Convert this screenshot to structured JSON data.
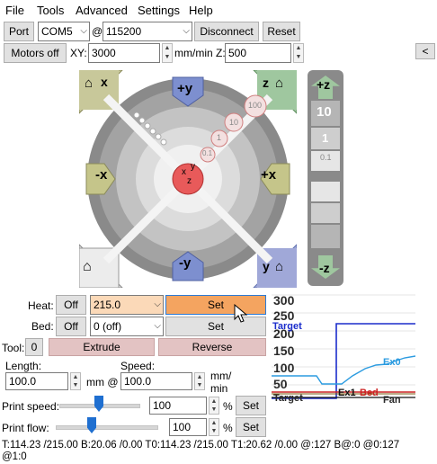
{
  "menu": [
    "File",
    "Tools",
    "Advanced",
    "Settings",
    "Help"
  ],
  "connection": {
    "port_label": "Port",
    "port_value": "COM5",
    "at": "@",
    "baud_value": "115200",
    "disconnect_label": "Disconnect",
    "reset_label": "Reset"
  },
  "motion": {
    "motors_off_label": "Motors off",
    "xy_label": "XY:",
    "xy_speed": "3000",
    "unit_label": "mm/min Z:",
    "z_speed": "500",
    "collapse_label": "<"
  },
  "jog": {
    "home_x": "x",
    "home_z": "z",
    "home_y": "y",
    "plus_y": "+y",
    "minus_y": "-y",
    "plus_x": "+x",
    "minus_x": "-x",
    "steps": [
      "100",
      "10",
      "1",
      "0.1"
    ],
    "center_labels": [
      "x",
      "y",
      "z"
    ],
    "plus_z": "+z",
    "minus_z": "-z",
    "z_steps": [
      "10",
      "1",
      "0.1"
    ]
  },
  "temps": {
    "heat_label": "Heat:",
    "heat_off": "Off",
    "heat_value": "215.0",
    "heat_set": "Set",
    "bed_label": "Bed:",
    "bed_off": "Off",
    "bed_value": "0 (off)",
    "bed_set": "Set"
  },
  "extrude": {
    "tool_label": "Tool:",
    "tool_value": "0",
    "extrude_label": "Extrude",
    "reverse_label": "Reverse",
    "length_label": "Length:",
    "length_value": "100.0",
    "mm_at": "mm @",
    "speed_label": "Speed:",
    "speed_value": "100.0",
    "speed_unit_1": "mm/",
    "speed_unit_2": "min"
  },
  "print_speed": {
    "label": "Print speed:",
    "value": "100",
    "unit": "%",
    "set": "Set",
    "level_percent": 100
  },
  "print_flow": {
    "label": "Print flow:",
    "value": "100",
    "unit": "%",
    "set": "Set",
    "level_percent": 100
  },
  "status": {
    "line1": "T:114.23 /215.00 B:20.06 /0.00 T0:114.23 /215.00 T1:20.62 /0.00 @:127 B@:0 @0:127",
    "line2": "@1:0"
  },
  "graph": {
    "y_ticks": [
      "300",
      "250",
      "200",
      "150",
      "100",
      "50"
    ],
    "labels": {
      "target_top": "Target",
      "ex0": "Ex0",
      "target_bottom": "Target",
      "ex1": "Ex1",
      "bed": "Bed",
      "fan": "Fan"
    },
    "colors": {
      "target": "#1b2dcc",
      "ex0": "#2b9be0",
      "ex1": "#111111",
      "bed": "#cc2222",
      "fan": "#7a5a10",
      "accent": "#f4a460"
    }
  }
}
